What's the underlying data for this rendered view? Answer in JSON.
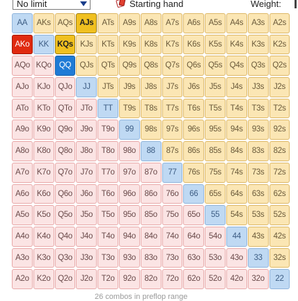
{
  "topbar": {
    "range_select": "No limit",
    "starting_hand_label": "Starting hand",
    "weight_label": "Weight:"
  },
  "grid": {
    "rows": [
      [
        "AA",
        "AKs",
        "AQs",
        "AJs",
        "ATs",
        "A9s",
        "A8s",
        "A7s",
        "A6s",
        "A5s",
        "A4s",
        "A3s",
        "A2s"
      ],
      [
        "AKo",
        "KK",
        "KQs",
        "KJs",
        "KTs",
        "K9s",
        "K8s",
        "K7s",
        "K6s",
        "K5s",
        "K4s",
        "K3s",
        "K2s"
      ],
      [
        "AQo",
        "KQo",
        "QQ",
        "QJs",
        "QTs",
        "Q9s",
        "Q8s",
        "Q7s",
        "Q6s",
        "Q5s",
        "Q4s",
        "Q3s",
        "Q2s"
      ],
      [
        "AJo",
        "KJo",
        "QJo",
        "JJ",
        "JTs",
        "J9s",
        "J8s",
        "J7s",
        "J6s",
        "J5s",
        "J4s",
        "J3s",
        "J2s"
      ],
      [
        "ATo",
        "KTo",
        "QTo",
        "JTo",
        "TT",
        "T9s",
        "T8s",
        "T7s",
        "T6s",
        "T5s",
        "T4s",
        "T3s",
        "T2s"
      ],
      [
        "A9o",
        "K9o",
        "Q9o",
        "J9o",
        "T9o",
        "99",
        "98s",
        "97s",
        "96s",
        "95s",
        "94s",
        "93s",
        "92s"
      ],
      [
        "A8o",
        "K8o",
        "Q8o",
        "J8o",
        "T8o",
        "98o",
        "88",
        "87s",
        "86s",
        "85s",
        "84s",
        "83s",
        "82s"
      ],
      [
        "A7o",
        "K7o",
        "Q7o",
        "J7o",
        "T7o",
        "97o",
        "87o",
        "77",
        "76s",
        "75s",
        "74s",
        "73s",
        "72s"
      ],
      [
        "A6o",
        "K6o",
        "Q6o",
        "J6o",
        "T6o",
        "96o",
        "86o",
        "76o",
        "66",
        "65s",
        "64s",
        "63s",
        "62s"
      ],
      [
        "A5o",
        "K5o",
        "Q5o",
        "J5o",
        "T5o",
        "95o",
        "85o",
        "75o",
        "65o",
        "55",
        "54s",
        "53s",
        "52s"
      ],
      [
        "A4o",
        "K4o",
        "Q4o",
        "J4o",
        "T4o",
        "94o",
        "84o",
        "74o",
        "64o",
        "54o",
        "44",
        "43s",
        "42s"
      ],
      [
        "A3o",
        "K3o",
        "Q3o",
        "J3o",
        "T3o",
        "93o",
        "83o",
        "73o",
        "63o",
        "53o",
        "43o",
        "33",
        "32s"
      ],
      [
        "A2o",
        "K2o",
        "Q2o",
        "J2o",
        "T2o",
        "92o",
        "82o",
        "72o",
        "62o",
        "52o",
        "42o",
        "32o",
        "22"
      ]
    ],
    "selected": [
      "AJs",
      "AKo",
      "KQs",
      "QQ"
    ]
  },
  "footer": {
    "combos_text": "26 combos in preflop range"
  },
  "colors": {
    "offsuit": "#fbe4e4",
    "suited": "#fbe6b4",
    "pair": "#bfd9f3",
    "selected_pair": "#1f7bd6",
    "selected_suited": "#f0c020",
    "selected_offsuit": "#e02a10"
  },
  "icons": {
    "starting_hand": "cards-icon",
    "dropdown": "chevron-down-icon"
  }
}
